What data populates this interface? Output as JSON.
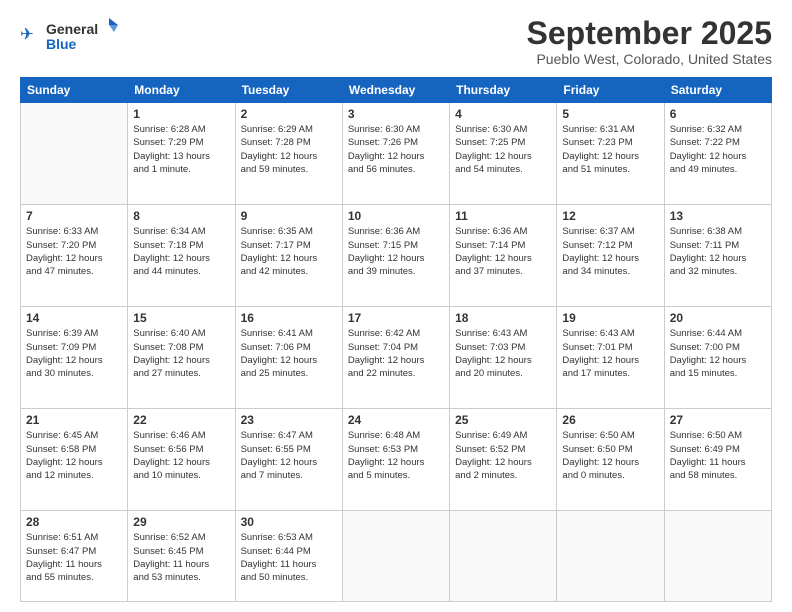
{
  "header": {
    "logo_general": "General",
    "logo_blue": "Blue",
    "month_title": "September 2025",
    "subtitle": "Pueblo West, Colorado, United States"
  },
  "days_of_week": [
    "Sunday",
    "Monday",
    "Tuesday",
    "Wednesday",
    "Thursday",
    "Friday",
    "Saturday"
  ],
  "weeks": [
    [
      {
        "day": "",
        "info": ""
      },
      {
        "day": "1",
        "info": "Sunrise: 6:28 AM\nSunset: 7:29 PM\nDaylight: 13 hours\nand 1 minute."
      },
      {
        "day": "2",
        "info": "Sunrise: 6:29 AM\nSunset: 7:28 PM\nDaylight: 12 hours\nand 59 minutes."
      },
      {
        "day": "3",
        "info": "Sunrise: 6:30 AM\nSunset: 7:26 PM\nDaylight: 12 hours\nand 56 minutes."
      },
      {
        "day": "4",
        "info": "Sunrise: 6:30 AM\nSunset: 7:25 PM\nDaylight: 12 hours\nand 54 minutes."
      },
      {
        "day": "5",
        "info": "Sunrise: 6:31 AM\nSunset: 7:23 PM\nDaylight: 12 hours\nand 51 minutes."
      },
      {
        "day": "6",
        "info": "Sunrise: 6:32 AM\nSunset: 7:22 PM\nDaylight: 12 hours\nand 49 minutes."
      }
    ],
    [
      {
        "day": "7",
        "info": "Sunrise: 6:33 AM\nSunset: 7:20 PM\nDaylight: 12 hours\nand 47 minutes."
      },
      {
        "day": "8",
        "info": "Sunrise: 6:34 AM\nSunset: 7:18 PM\nDaylight: 12 hours\nand 44 minutes."
      },
      {
        "day": "9",
        "info": "Sunrise: 6:35 AM\nSunset: 7:17 PM\nDaylight: 12 hours\nand 42 minutes."
      },
      {
        "day": "10",
        "info": "Sunrise: 6:36 AM\nSunset: 7:15 PM\nDaylight: 12 hours\nand 39 minutes."
      },
      {
        "day": "11",
        "info": "Sunrise: 6:36 AM\nSunset: 7:14 PM\nDaylight: 12 hours\nand 37 minutes."
      },
      {
        "day": "12",
        "info": "Sunrise: 6:37 AM\nSunset: 7:12 PM\nDaylight: 12 hours\nand 34 minutes."
      },
      {
        "day": "13",
        "info": "Sunrise: 6:38 AM\nSunset: 7:11 PM\nDaylight: 12 hours\nand 32 minutes."
      }
    ],
    [
      {
        "day": "14",
        "info": "Sunrise: 6:39 AM\nSunset: 7:09 PM\nDaylight: 12 hours\nand 30 minutes."
      },
      {
        "day": "15",
        "info": "Sunrise: 6:40 AM\nSunset: 7:08 PM\nDaylight: 12 hours\nand 27 minutes."
      },
      {
        "day": "16",
        "info": "Sunrise: 6:41 AM\nSunset: 7:06 PM\nDaylight: 12 hours\nand 25 minutes."
      },
      {
        "day": "17",
        "info": "Sunrise: 6:42 AM\nSunset: 7:04 PM\nDaylight: 12 hours\nand 22 minutes."
      },
      {
        "day": "18",
        "info": "Sunrise: 6:43 AM\nSunset: 7:03 PM\nDaylight: 12 hours\nand 20 minutes."
      },
      {
        "day": "19",
        "info": "Sunrise: 6:43 AM\nSunset: 7:01 PM\nDaylight: 12 hours\nand 17 minutes."
      },
      {
        "day": "20",
        "info": "Sunrise: 6:44 AM\nSunset: 7:00 PM\nDaylight: 12 hours\nand 15 minutes."
      }
    ],
    [
      {
        "day": "21",
        "info": "Sunrise: 6:45 AM\nSunset: 6:58 PM\nDaylight: 12 hours\nand 12 minutes."
      },
      {
        "day": "22",
        "info": "Sunrise: 6:46 AM\nSunset: 6:56 PM\nDaylight: 12 hours\nand 10 minutes."
      },
      {
        "day": "23",
        "info": "Sunrise: 6:47 AM\nSunset: 6:55 PM\nDaylight: 12 hours\nand 7 minutes."
      },
      {
        "day": "24",
        "info": "Sunrise: 6:48 AM\nSunset: 6:53 PM\nDaylight: 12 hours\nand 5 minutes."
      },
      {
        "day": "25",
        "info": "Sunrise: 6:49 AM\nSunset: 6:52 PM\nDaylight: 12 hours\nand 2 minutes."
      },
      {
        "day": "26",
        "info": "Sunrise: 6:50 AM\nSunset: 6:50 PM\nDaylight: 12 hours\nand 0 minutes."
      },
      {
        "day": "27",
        "info": "Sunrise: 6:50 AM\nSunset: 6:49 PM\nDaylight: 11 hours\nand 58 minutes."
      }
    ],
    [
      {
        "day": "28",
        "info": "Sunrise: 6:51 AM\nSunset: 6:47 PM\nDaylight: 11 hours\nand 55 minutes."
      },
      {
        "day": "29",
        "info": "Sunrise: 6:52 AM\nSunset: 6:45 PM\nDaylight: 11 hours\nand 53 minutes."
      },
      {
        "day": "30",
        "info": "Sunrise: 6:53 AM\nSunset: 6:44 PM\nDaylight: 11 hours\nand 50 minutes."
      },
      {
        "day": "",
        "info": ""
      },
      {
        "day": "",
        "info": ""
      },
      {
        "day": "",
        "info": ""
      },
      {
        "day": "",
        "info": ""
      }
    ]
  ]
}
